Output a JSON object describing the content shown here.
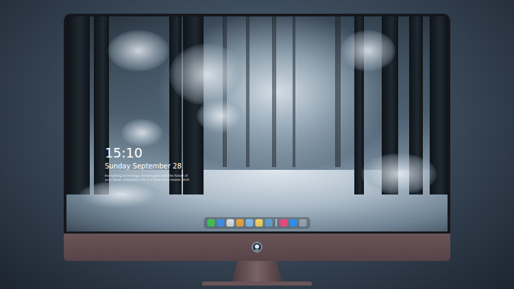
{
  "desktop": {
    "clock": {
      "time": "15:10",
      "date": "Sunday September 28",
      "caption": [
        "Everything technology. Ensure glass and the future of",
        "your ideas compared it for a of what they means 2020"
      ]
    },
    "dock": {
      "items": [
        {
          "kind": "app",
          "color": "#3ec24f"
        },
        {
          "kind": "app",
          "color": "#3a8ee6"
        },
        {
          "kind": "app",
          "color": "#d8dde2"
        },
        {
          "kind": "app",
          "color": "#e9a23b"
        },
        {
          "kind": "app",
          "color": "#7fb6e8"
        },
        {
          "kind": "app",
          "color": "#f4d35e"
        },
        {
          "kind": "app",
          "color": "#5a9fd6"
        },
        {
          "kind": "separator",
          "color": "#ffffff"
        },
        {
          "kind": "app",
          "color": "#f0487a"
        },
        {
          "kind": "app",
          "color": "#2f8df0"
        },
        {
          "kind": "app",
          "color": "#9aa2ab"
        }
      ]
    }
  }
}
